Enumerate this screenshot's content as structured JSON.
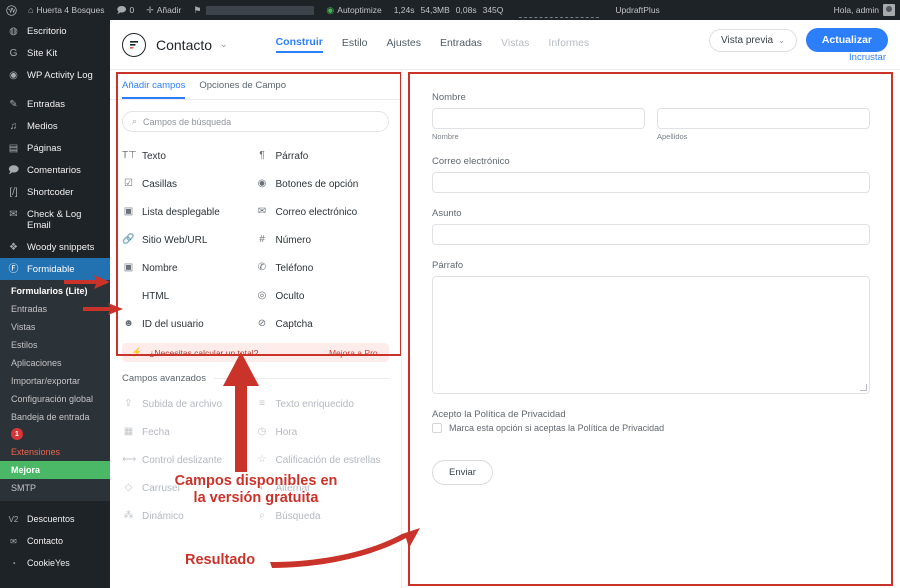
{
  "adminbar": {
    "logo_icon": "wordpress-icon",
    "home_icon": "home-icon",
    "site_name": "Huerta 4 Bosques",
    "comments_icon": "comment-icon",
    "comments_count": "0",
    "new_icon": "plus-icon",
    "new_label": "Añadir",
    "flag_icon": "flag-icon",
    "autoptimize_label": "Autoptimize",
    "perf_time": "1,24s",
    "perf_mem": "54,3MB",
    "perf_db": "0,08s",
    "perf_queries": "345Q",
    "updraft_label": "UpdraftPlus",
    "greeting": "Hola, admin",
    "avatar_icon": "user-avatar-icon"
  },
  "sidebar": {
    "items": [
      {
        "icon": "dashboard-icon",
        "glyph": "◍",
        "label": "Escritorio"
      },
      {
        "icon": "google-site-kit-icon",
        "glyph": "G",
        "label": "Site Kit"
      },
      {
        "icon": "shield-icon",
        "glyph": "◉",
        "label": "WP Activity Log"
      },
      {
        "icon": "pin-icon",
        "glyph": "✎",
        "label": "Entradas",
        "gap_before": true
      },
      {
        "icon": "media-icon",
        "glyph": "♫",
        "label": "Medios"
      },
      {
        "icon": "pages-icon",
        "glyph": "▤",
        "label": "Páginas"
      },
      {
        "icon": "comment-icon",
        "glyph": "🗩",
        "label": "Comentarios"
      },
      {
        "icon": "shortcoder-icon",
        "glyph": "[/]",
        "label": "Shortcoder"
      },
      {
        "icon": "mail-icon",
        "glyph": "✉",
        "label": "Check & Log Email"
      },
      {
        "icon": "woody-snippets-icon",
        "glyph": "❖",
        "label": "Woody snippets"
      }
    ],
    "active_item": {
      "icon": "formidable-icon",
      "glyph": "Ⓕ",
      "label": "Formidable"
    },
    "submenu": [
      {
        "label": "Formularios (Lite)",
        "state": "current"
      },
      {
        "label": "Entradas",
        "state": "normal"
      },
      {
        "label": "Vistas",
        "state": "normal"
      },
      {
        "label": "Estilos",
        "state": "normal"
      },
      {
        "label": "Aplicaciones",
        "state": "normal"
      },
      {
        "label": "Importar/exportar",
        "state": "normal"
      },
      {
        "label": "Configuración global",
        "state": "normal"
      },
      {
        "label": "Bandeja de entrada",
        "state": "normal",
        "badge": "1"
      },
      {
        "label": "Extensiones",
        "state": "orange"
      },
      {
        "label": "Mejora",
        "state": "green"
      },
      {
        "label": "SMTP",
        "state": "normal"
      }
    ],
    "after_items": [
      {
        "icon": "discounts-icon",
        "glyph": "V2",
        "label": "Descuentos"
      },
      {
        "icon": "mail-icon",
        "glyph": "✉",
        "label": "Contacto"
      },
      {
        "icon": "cookieyes-icon",
        "glyph": "◔",
        "label": "CookieYes"
      }
    ]
  },
  "form_header": {
    "logo_icon": "formidable-logo-icon",
    "title": "Contacto",
    "caret_icon": "chevron-down-icon",
    "tabs": [
      {
        "label": "Construir",
        "state": "selected"
      },
      {
        "label": "Estilo",
        "state": "normal"
      },
      {
        "label": "Ajustes",
        "state": "normal"
      },
      {
        "label": "Entradas",
        "state": "normal"
      },
      {
        "label": "Vistas",
        "state": "dim"
      },
      {
        "label": "Informes",
        "state": "dim"
      }
    ],
    "preview_label": "Vista previa",
    "preview_caret_icon": "chevron-down-icon",
    "update_label": "Actualizar",
    "embed_label": "Incrustar"
  },
  "fields_panel": {
    "tabs": [
      {
        "label": "Añadir campos",
        "state": "selected"
      },
      {
        "label": "Opciones de Campo",
        "state": "normal"
      }
    ],
    "search": {
      "icon": "search-icon",
      "placeholder": "Campos de búsqueda",
      "value": ""
    },
    "basic_fields": [
      {
        "icon": "text-icon",
        "glyph": "T⊤",
        "label": "Texto"
      },
      {
        "icon": "paragraph-icon",
        "glyph": "¶",
        "label": "Párrafo"
      },
      {
        "icon": "checkbox-icon",
        "glyph": "☑",
        "label": "Casillas"
      },
      {
        "icon": "radio-icon",
        "glyph": "◉",
        "label": "Botones de opción"
      },
      {
        "icon": "dropdown-icon",
        "glyph": "▣",
        "label": "Lista desplegable"
      },
      {
        "icon": "email-icon",
        "glyph": "✉",
        "label": "Correo electrónico"
      },
      {
        "icon": "link-icon",
        "glyph": "🔗",
        "label": "Sitio Web/URL"
      },
      {
        "icon": "number-icon",
        "glyph": "#",
        "label": "Número"
      },
      {
        "icon": "name-icon",
        "glyph": "▣",
        "label": "Nombre"
      },
      {
        "icon": "phone-icon",
        "glyph": "✆",
        "label": "Teléfono"
      },
      {
        "icon": "code-icon",
        "glyph": "</>",
        "label": "HTML"
      },
      {
        "icon": "hidden-eye-icon",
        "glyph": "◎",
        "label": "Oculto"
      },
      {
        "icon": "user-icon",
        "glyph": "☻",
        "label": "ID del usuario"
      },
      {
        "icon": "captcha-shield-icon",
        "glyph": "⊘",
        "label": "Captcha"
      }
    ],
    "pro_banner": {
      "icon": "lightning-icon",
      "text": "¿Necesitas calcular un total?",
      "link": "Mejora a Pro."
    },
    "advanced_title": "Campos avanzados",
    "advanced_fields": [
      {
        "icon": "upload-icon",
        "glyph": "⇪",
        "label": "Subida de archivo"
      },
      {
        "icon": "rich-text-icon",
        "glyph": "≡",
        "label": "Texto enriquecido"
      },
      {
        "icon": "calendar-icon",
        "glyph": "▦",
        "label": "Fecha"
      },
      {
        "icon": "clock-icon",
        "glyph": "◷",
        "label": "Hora"
      },
      {
        "icon": "slider-icon",
        "glyph": "⟷",
        "label": "Control deslizante"
      },
      {
        "icon": "star-rating-icon",
        "glyph": "☆",
        "label": "Calificación de estrellas"
      },
      {
        "icon": "carousel-icon",
        "glyph": "◇",
        "label": "Carrusel"
      },
      {
        "icon": "toggle-icon",
        "glyph": "◐",
        "label": "Alternar"
      },
      {
        "icon": "dynamic-icon",
        "glyph": "⁂",
        "label": "Dinámico"
      },
      {
        "icon": "search-icon",
        "glyph": "⌕",
        "label": "Búsqueda"
      }
    ]
  },
  "preview": {
    "fields": [
      {
        "label": "Nombre",
        "type": "name",
        "sub_first": "Nombre",
        "sub_last": "Apellidos"
      },
      {
        "label": "Correo electrónico",
        "type": "input"
      },
      {
        "label": "Asunto",
        "type": "input"
      },
      {
        "label": "Párrafo",
        "type": "textarea"
      },
      {
        "label": "Acepto la Política de Privacidad",
        "type": "checkbox",
        "option": "Marca esta opción si aceptas la Política de Privacidad"
      }
    ],
    "submit_label": "Enviar"
  },
  "annotations": {
    "free_fields_line1": "Campos disponibles en",
    "free_fields_line2": "la versión gratuita",
    "result": "Resultado"
  },
  "colors": {
    "accent_blue": "#2d7ff9",
    "annotation_red": "#c9332a",
    "sidebar_bg": "#1d2327",
    "active_menu_blue": "#2271b1",
    "upgrade_green": "#4ab866",
    "extensions_orange": "#e8644b"
  }
}
